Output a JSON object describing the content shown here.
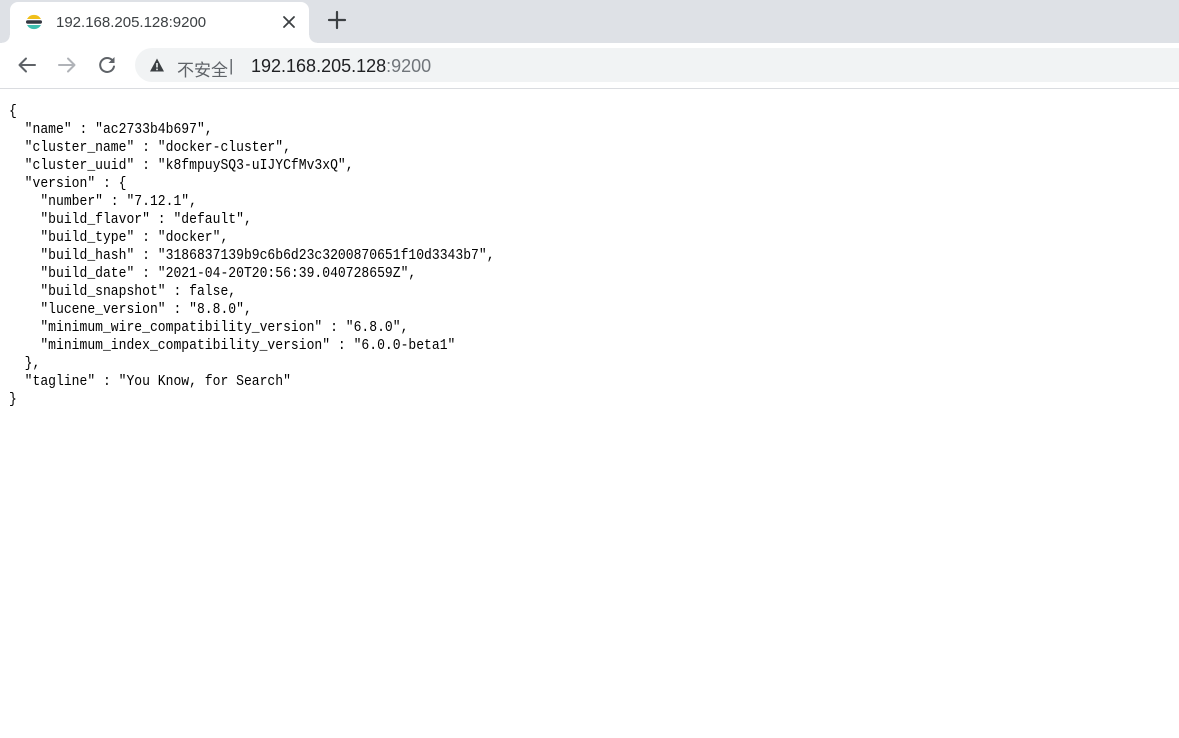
{
  "browser": {
    "tab": {
      "title": "192.168.205.128:9200",
      "favicon": "elasticsearch-icon"
    },
    "toolbar": {
      "back_icon": "back-arrow-icon",
      "forward_icon": "forward-arrow-icon",
      "reload_icon": "reload-icon",
      "security_warning": "不安全",
      "separator": "|",
      "url_host": "192.168.205.128",
      "url_port": ":9200"
    }
  },
  "page": {
    "json_text": "{\n  \"name\" : \"ac2733b4b697\",\n  \"cluster_name\" : \"docker-cluster\",\n  \"cluster_uuid\" : \"k8fmpuySQ3-uIJYCfMv3xQ\",\n  \"version\" : {\n    \"number\" : \"7.12.1\",\n    \"build_flavor\" : \"default\",\n    \"build_type\" : \"docker\",\n    \"build_hash\" : \"3186837139b9c6b6d23c3200870651f10d3343b7\",\n    \"build_date\" : \"2021-04-20T20:56:39.040728659Z\",\n    \"build_snapshot\" : false,\n    \"lucene_version\" : \"8.8.0\",\n    \"minimum_wire_compatibility_version\" : \"6.8.0\",\n    \"minimum_index_compatibility_version\" : \"6.0.0-beta1\"\n  },\n  \"tagline\" : \"You Know, for Search\"\n}"
  },
  "colors": {
    "tabstrip_bg": "#dee1e6",
    "omnibox_bg": "#f1f3f4",
    "favicon_yellow": "#f0bf1a",
    "favicon_teal": "#3ebeb0",
    "favicon_dark": "#343741"
  }
}
